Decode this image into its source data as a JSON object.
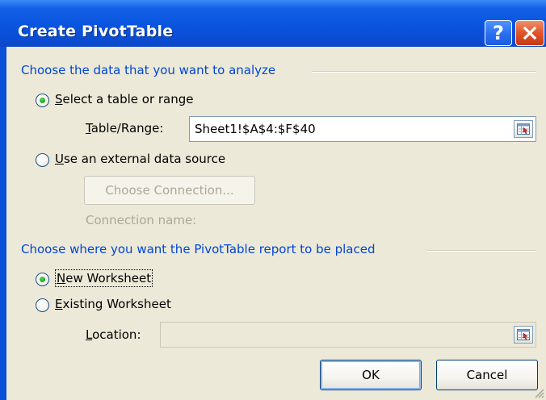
{
  "window": {
    "title": "Create PivotTable",
    "help_glyph": "?",
    "close_icon": "close-x-icon"
  },
  "source_group": {
    "heading": "Choose the data that you want to analyze",
    "option_table": {
      "prefix": "",
      "accel": "S",
      "rest": "elect a table or range",
      "checked": true
    },
    "table_range_label": {
      "accel": "T",
      "rest": "able/Range:"
    },
    "table_range_value": "Sheet1!$A$4:$F$40",
    "option_external": {
      "accel": "U",
      "rest": "se an external data source",
      "checked": false
    },
    "choose_connection_label": "Choose Connection...",
    "connection_name_label": "Connection name:"
  },
  "destination_group": {
    "heading": "Choose where you want the PivotTable report to be placed",
    "option_new": {
      "accel": "N",
      "rest": "ew Worksheet",
      "checked": true
    },
    "option_existing": {
      "accel": "E",
      "rest": "xisting Worksheet",
      "checked": false
    },
    "location_label": {
      "accel": "L",
      "rest": "ocation:"
    },
    "location_value": ""
  },
  "footer": {
    "ok_label": "OK",
    "cancel_label": "Cancel"
  },
  "colors": {
    "title_bar": "#0a4fd6",
    "group_heading": "#0046d5",
    "dialog_face": "#ece9d8"
  }
}
